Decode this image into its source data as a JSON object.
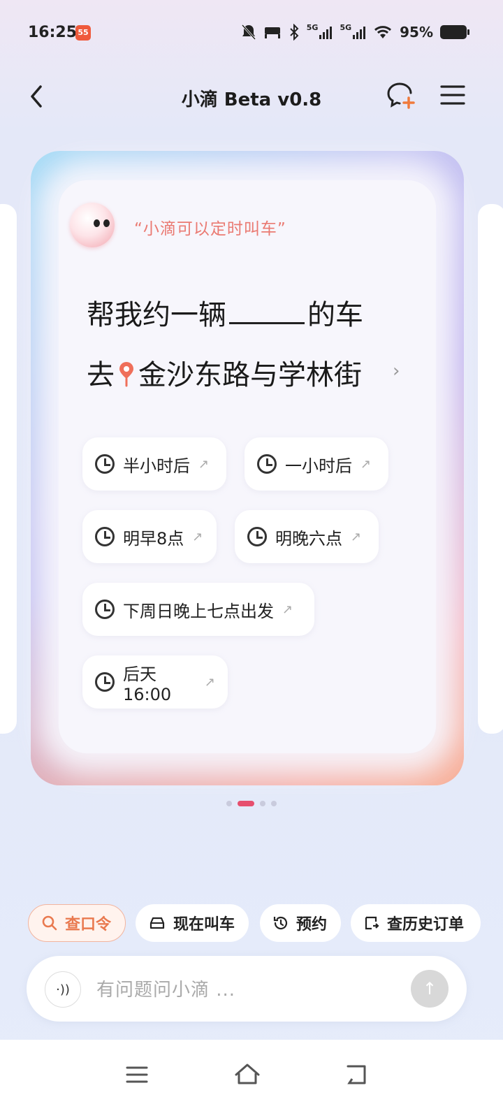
{
  "status_bar": {
    "time": "16:25",
    "app_badge": "55",
    "network_1": "5G",
    "network_2": "5G",
    "battery": "95%"
  },
  "header": {
    "title": "小滴 Beta v0.8"
  },
  "card": {
    "quote": "“小滴可以定时叫车”",
    "prompt_prefix": "帮我约一辆",
    "prompt_suffix": "的车",
    "dest_prefix": "去",
    "destination": "金沙东路与学林街"
  },
  "time_options": [
    {
      "label": "半小时后"
    },
    {
      "label": "一小时后"
    },
    {
      "label": "明早8点"
    },
    {
      "label": "明晚六点"
    },
    {
      "label": "下周日晚上七点出发"
    },
    {
      "label": "后天16:00"
    }
  ],
  "pager": {
    "count": 4,
    "active": 1
  },
  "quick_actions": [
    {
      "label": "查口令",
      "icon": "search-icon"
    },
    {
      "label": "现在叫车",
      "icon": "car-icon"
    },
    {
      "label": "预约",
      "icon": "clock-history-icon"
    },
    {
      "label": "查历史订单",
      "icon": "order-history-icon"
    }
  ],
  "input": {
    "placeholder": "有问题问小滴 ..."
  },
  "colors": {
    "accent": "#e64f6e",
    "quote": "#ea7a72",
    "primary_chip": "#e9794f"
  }
}
